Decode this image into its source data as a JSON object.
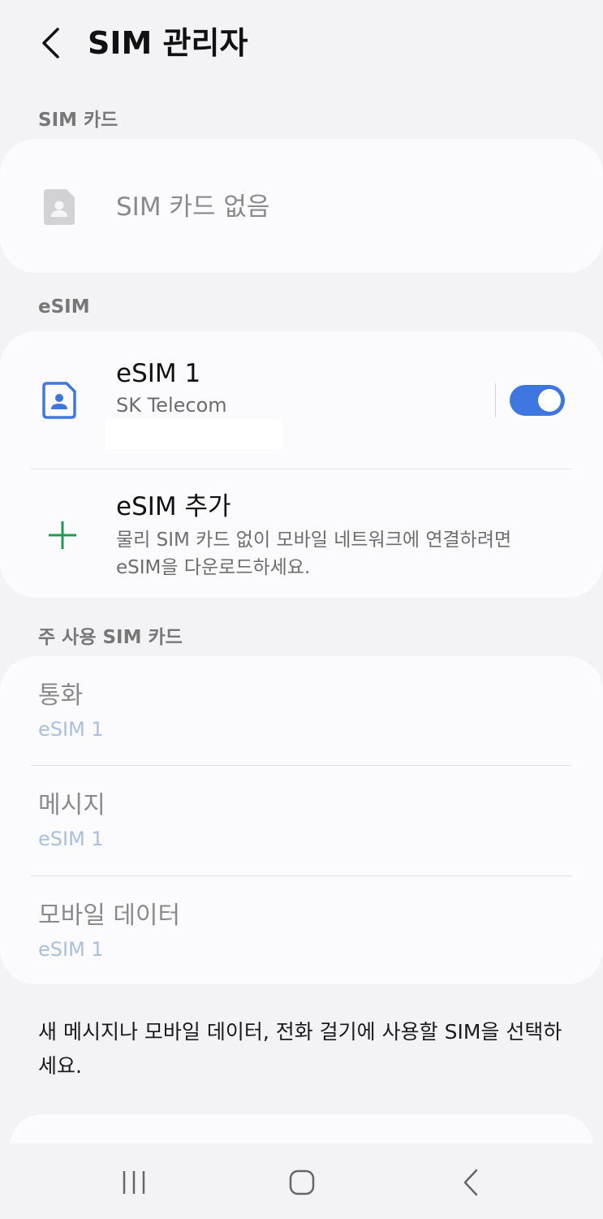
{
  "header": {
    "title": "SIM 관리자",
    "back_icon": "chevron-left-icon"
  },
  "sim_card_section": {
    "label": "SIM 카드",
    "empty_text": "SIM 카드 없음",
    "icon": "sim-card-icon"
  },
  "esim_section": {
    "label": "eSIM",
    "esim1": {
      "name": "eSIM 1",
      "carrier": "SK Telecom",
      "enabled": true,
      "icon": "esim-contact-icon",
      "accent_color": "#3e77e0"
    },
    "add": {
      "title": "eSIM 추가",
      "description": "물리 SIM 카드 없이 모바일 네트워크에 연결하려면 eSIM을 다운로드하세요.",
      "icon": "plus-icon",
      "icon_color": "#1d9d4f"
    }
  },
  "preferred_section": {
    "label": "주 사용 SIM 카드",
    "items": [
      {
        "title": "통화",
        "value": "eSIM 1"
      },
      {
        "title": "메시지",
        "value": "eSIM 1"
      },
      {
        "title": "모바일 데이터",
        "value": "eSIM 1"
      }
    ]
  },
  "footer_note": "새 메시지나 모바일 데이터, 전화 걸기에 사용할 SIM을 선택하세요.",
  "navbar": {
    "recents_icon": "recent-apps-icon",
    "home_icon": "home-icon",
    "back_icon": "back-icon"
  }
}
